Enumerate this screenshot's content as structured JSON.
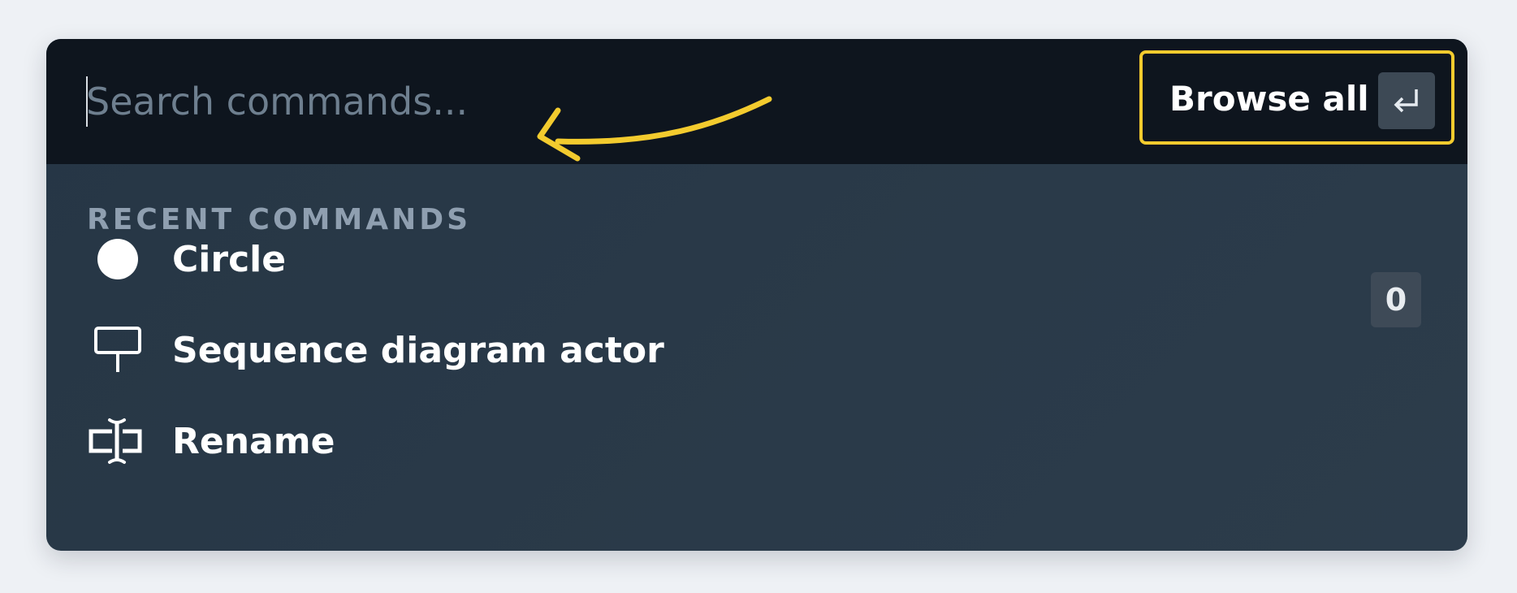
{
  "search": {
    "placeholder": "Search commands...",
    "value": ""
  },
  "browse_button": {
    "label": "Browse all",
    "key_icon": "enter-key-icon"
  },
  "annotation": {
    "arrow_color": "#f3cb2e",
    "highlight_color": "#f3cb2e"
  },
  "recent": {
    "title": "RECENT COMMANDS",
    "items": [
      {
        "label": "Circle",
        "icon": "circle-icon",
        "shortcut": "0"
      },
      {
        "label": "Sequence diagram actor",
        "icon": "sequence-actor-icon"
      },
      {
        "label": "Rename",
        "icon": "rename-icon"
      }
    ]
  },
  "colors": {
    "search_bar_bg": "#0e151e",
    "panel_bg": "#2a3a49",
    "section_title": "#8f9fb0",
    "badge_bg": "#3e4a57"
  }
}
